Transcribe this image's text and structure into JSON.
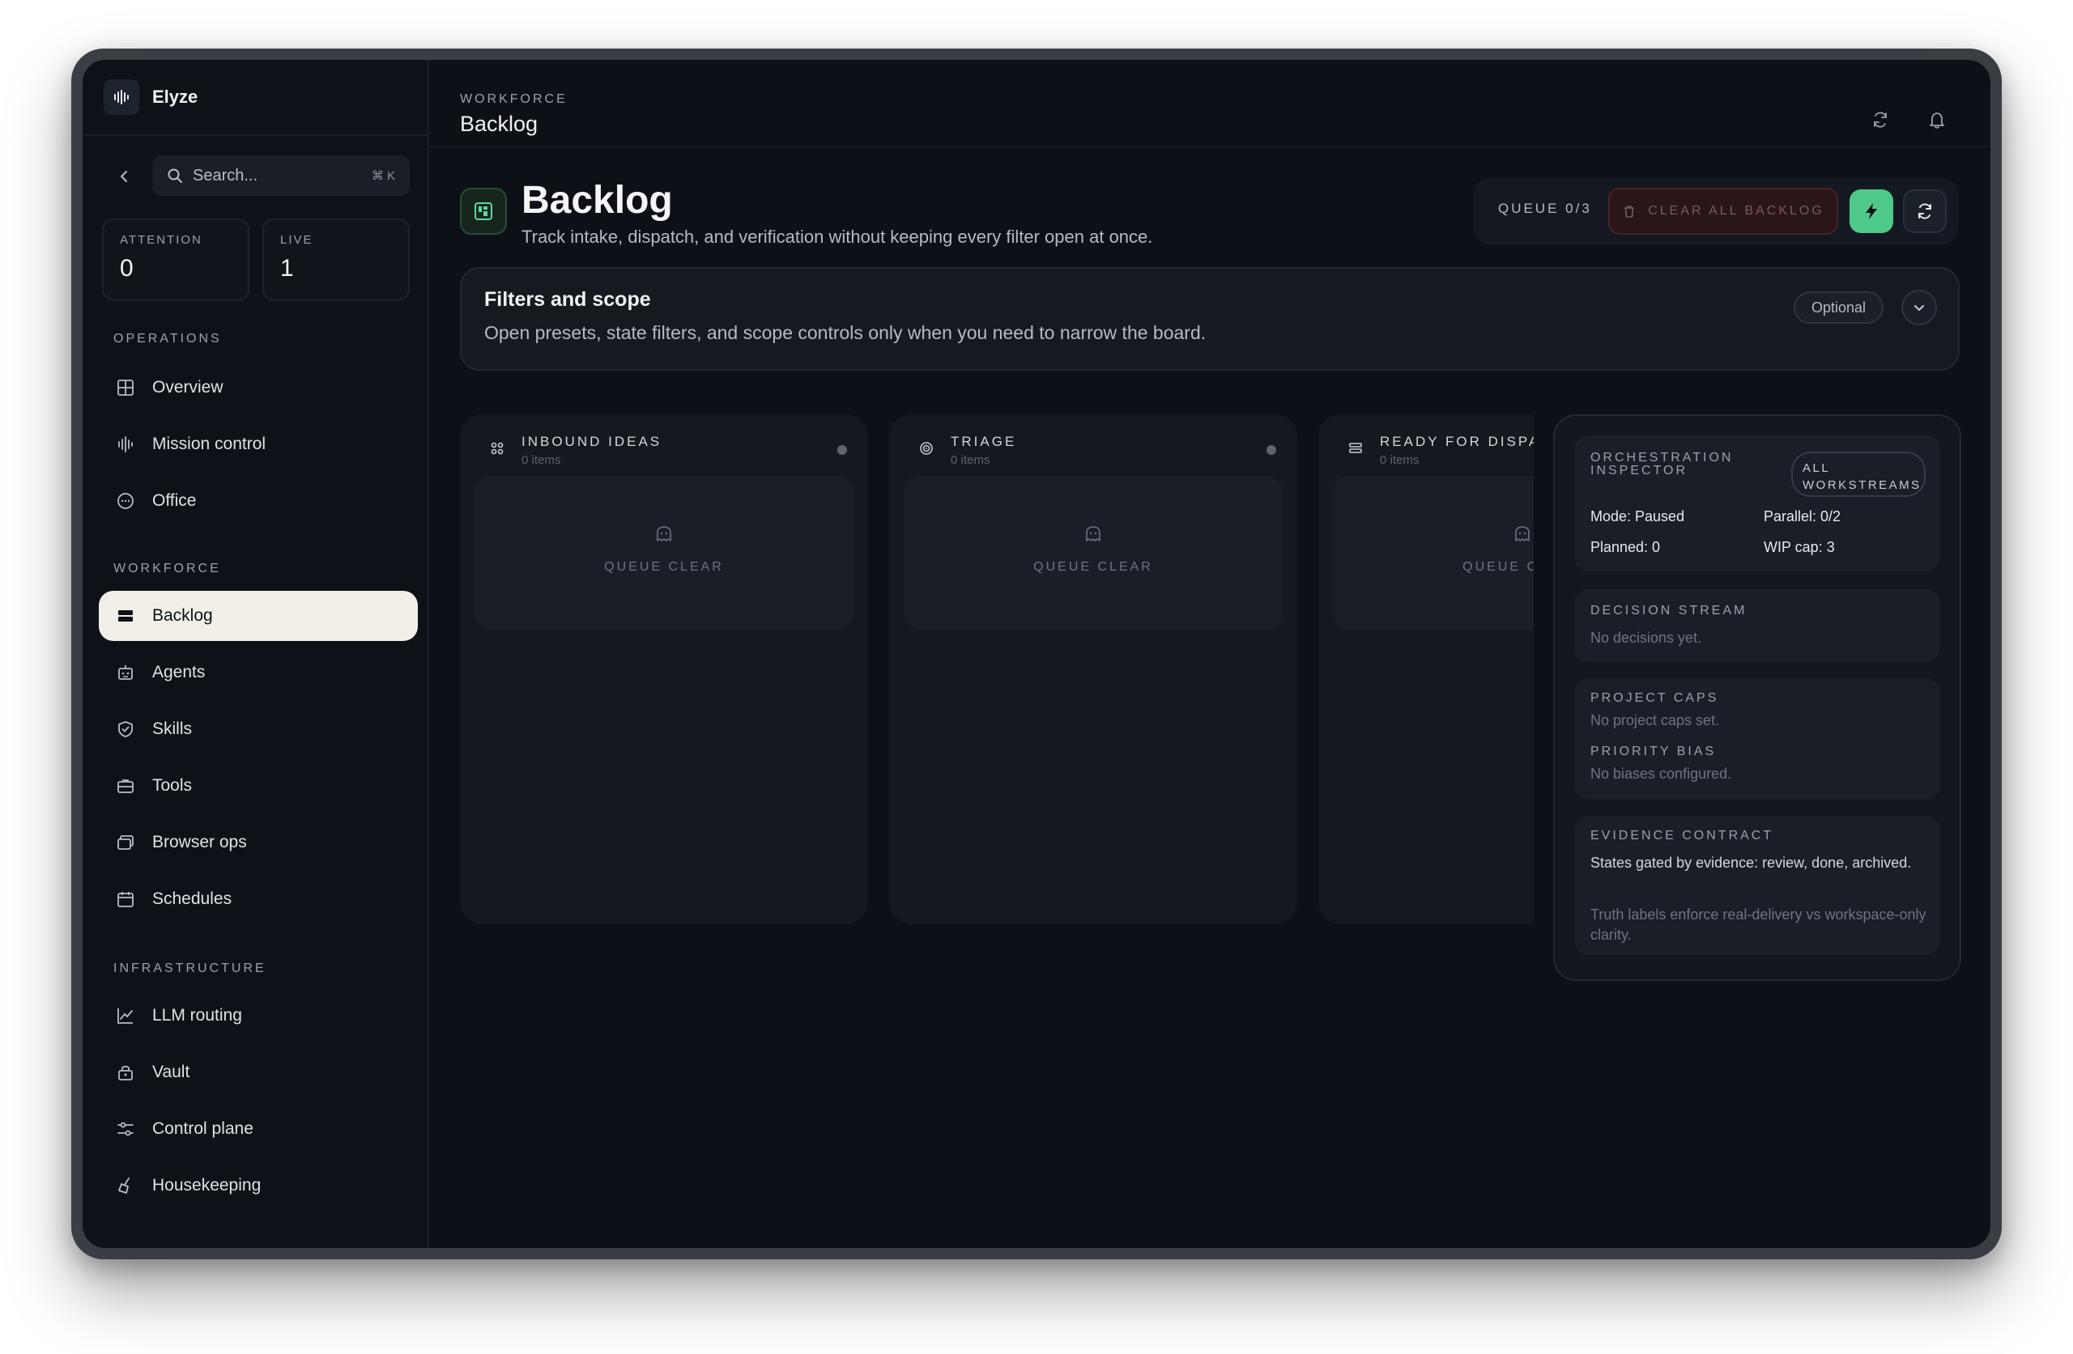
{
  "app": {
    "name": "Elyze"
  },
  "search": {
    "placeholder": "Search...",
    "shortcut": "⌘ K"
  },
  "stats": [
    {
      "label": "ATTENTION",
      "value": "0"
    },
    {
      "label": "LIVE",
      "value": "1"
    }
  ],
  "sidebar": {
    "sections": [
      {
        "title": "OPERATIONS",
        "items": [
          "Overview",
          "Mission control",
          "Office"
        ]
      },
      {
        "title": "WORKFORCE",
        "items": [
          "Backlog",
          "Agents",
          "Skills",
          "Tools",
          "Browser ops",
          "Schedules"
        ]
      },
      {
        "title": "INFRASTRUCTURE",
        "items": [
          "LLM routing",
          "Vault",
          "Control plane",
          "Housekeeping"
        ]
      }
    ],
    "active": "Backlog"
  },
  "header": {
    "section": "WORKFORCE",
    "title": "Backlog"
  },
  "page": {
    "title": "Backlog",
    "subtitle": "Track intake, dispatch, and verification without keeping every filter open at once."
  },
  "toolbar": {
    "queue": "QUEUE 0/3",
    "clear_label": "CLEAR ALL BACKLOG"
  },
  "filters": {
    "title": "Filters and scope",
    "description": "Open presets, state filters, and scope controls only when you need to narrow the board.",
    "badge": "Optional"
  },
  "columns": [
    {
      "name": "INBOUND IDEAS",
      "count": "0 items",
      "empty": "QUEUE CLEAR",
      "icon": "grid-dots-icon"
    },
    {
      "name": "TRIAGE",
      "count": "0 items",
      "empty": "QUEUE CLEAR",
      "icon": "target-icon"
    },
    {
      "name": "READY FOR DISPATCH",
      "count": "0 items",
      "empty": "QUEUE CLEAR",
      "icon": "stack-icon"
    }
  ],
  "inspector": {
    "title": "ORCHESTRATION INSPECTOR",
    "workstreams_label": "ALL WORKSTREAMS",
    "mode": "Mode: Paused",
    "parallel": "Parallel: 0/2",
    "planned": "Planned: 0",
    "wip": "WIP cap: 3",
    "decision_title": "DECISION STREAM",
    "decision_empty": "No decisions yet.",
    "caps_title": "PROJECT CAPS",
    "caps_empty": "No project caps set.",
    "bias_title": "PRIORITY BIAS",
    "bias_empty": "No biases configured.",
    "evidence_title": "EVIDENCE CONTRACT",
    "evidence_text": "States gated by evidence: review, done, archived.",
    "evidence_note": "Truth labels enforce real-delivery vs workspace-only clarity."
  },
  "colors": {
    "accent": "#4fc98a",
    "active_nav": "#f1efe8",
    "danger_bg": "#2a1518"
  }
}
